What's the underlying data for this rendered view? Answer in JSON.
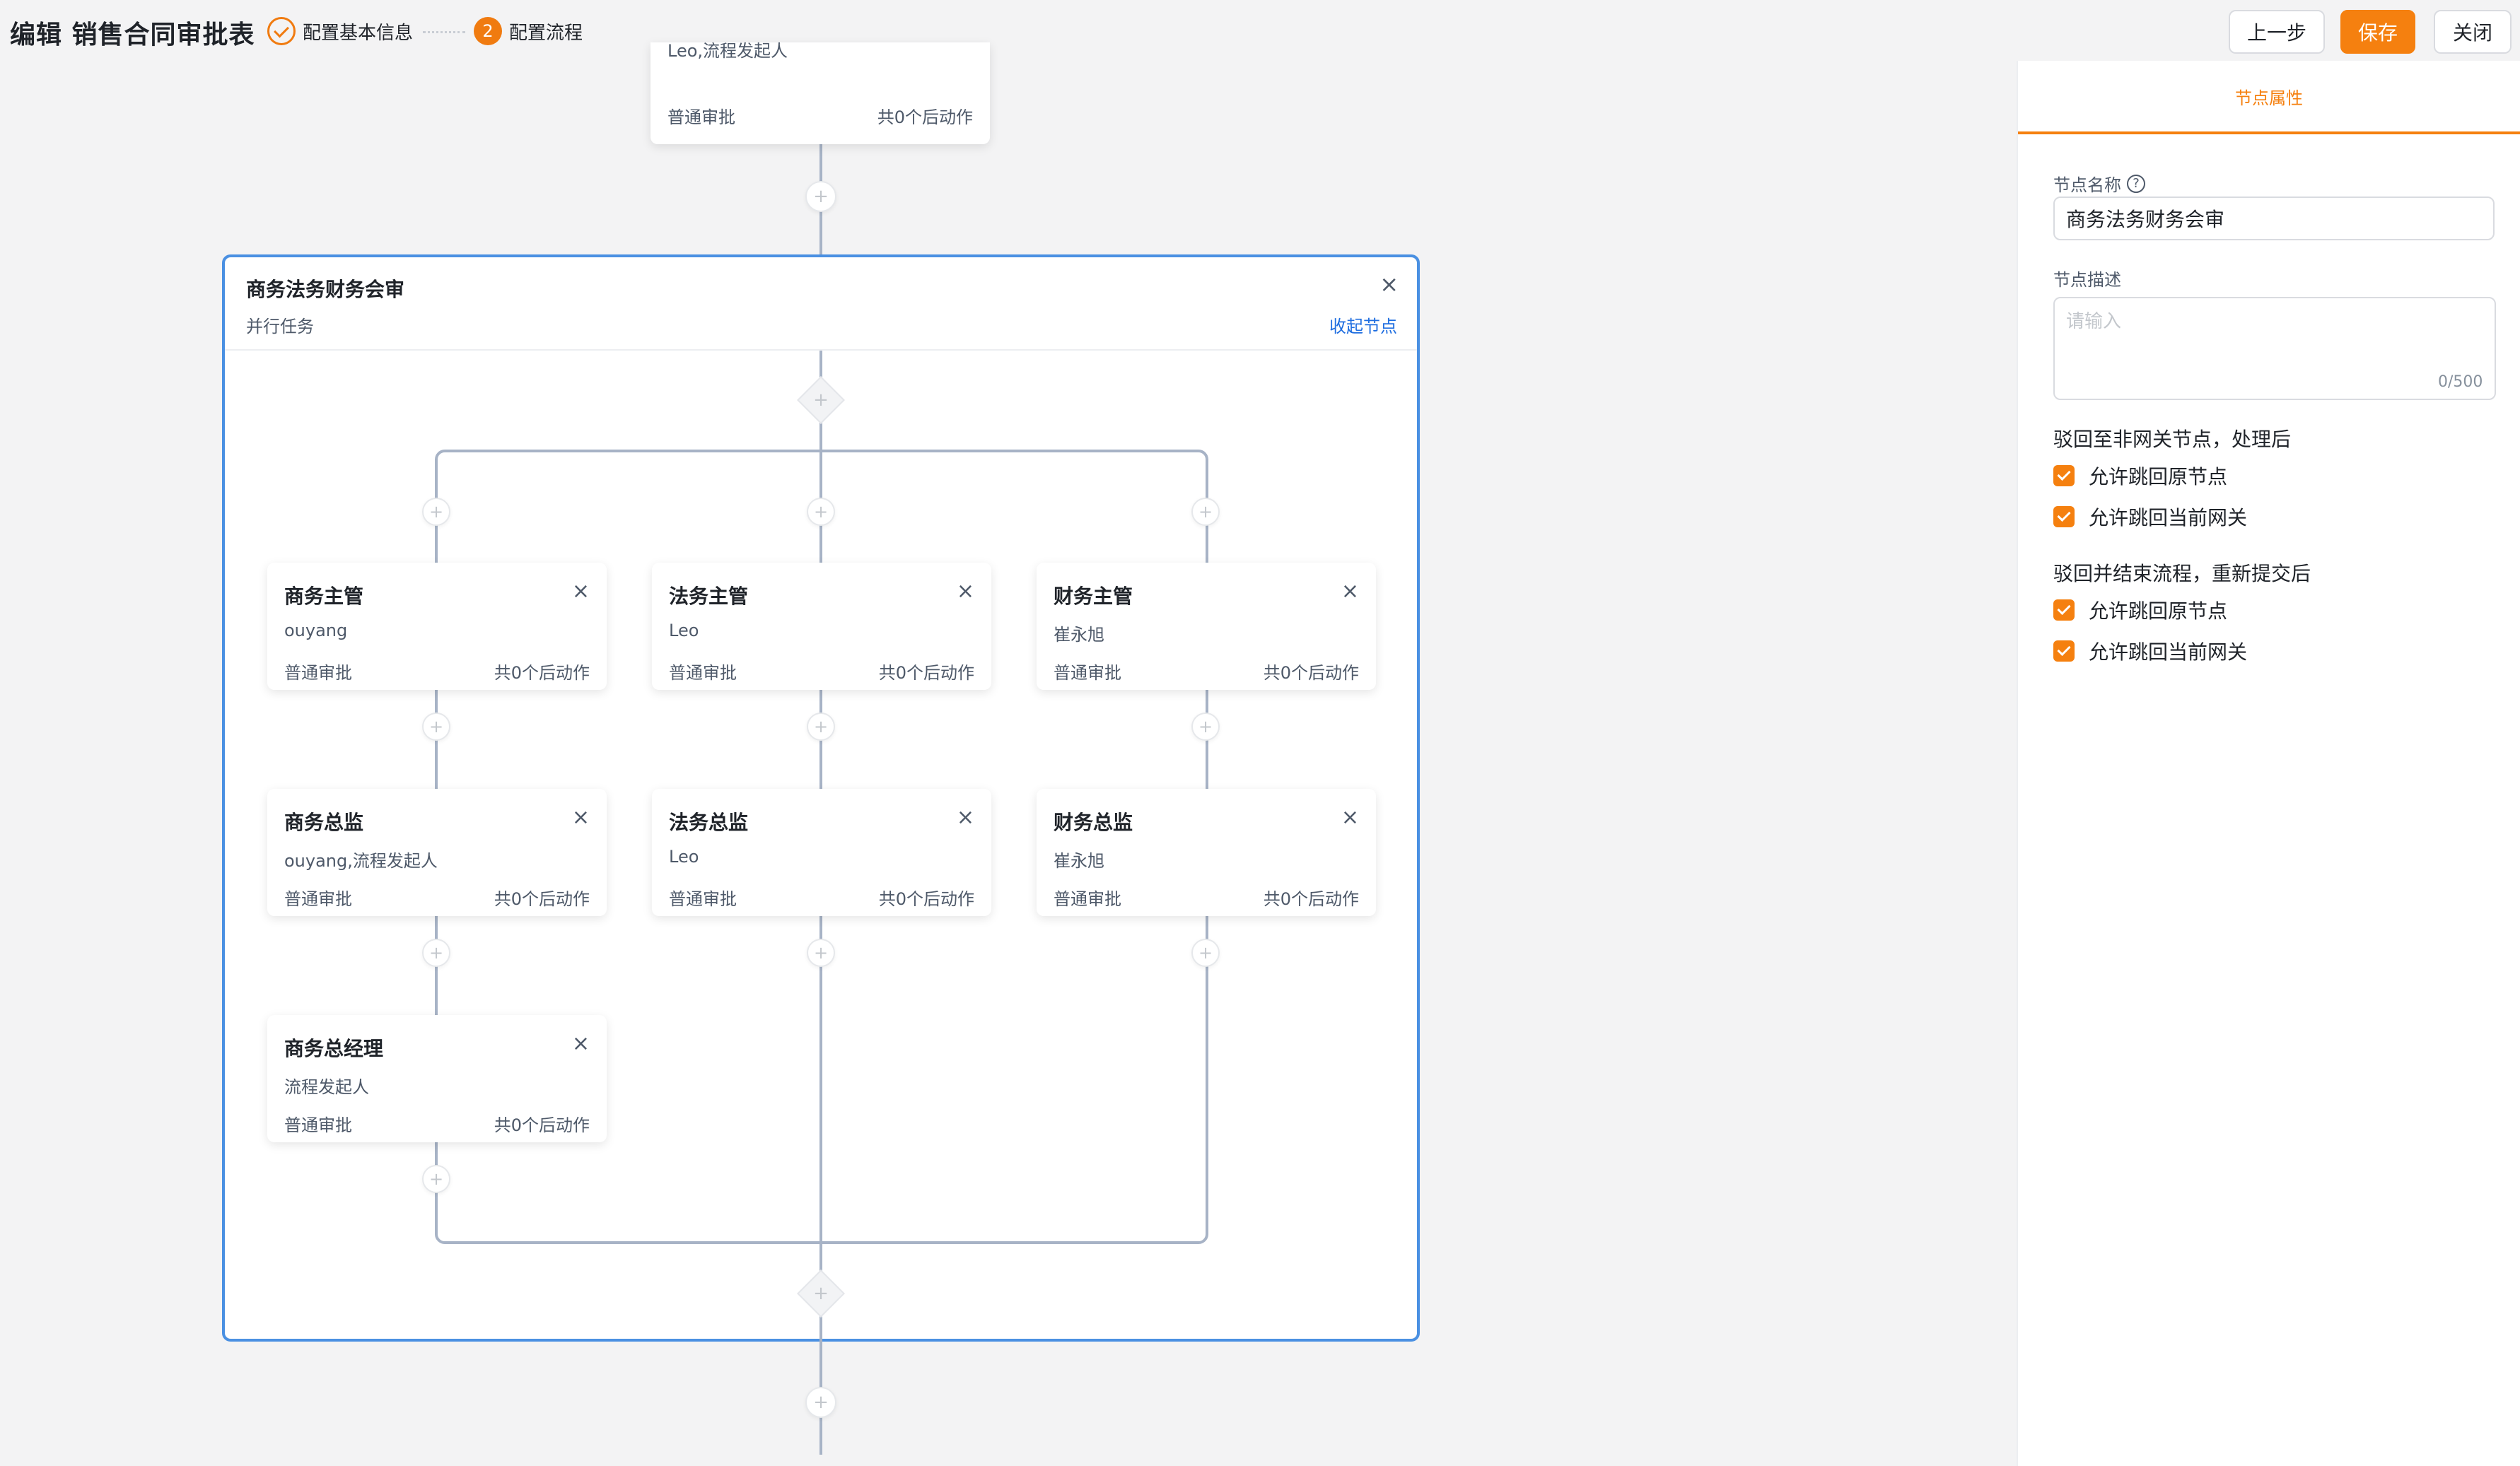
{
  "header": {
    "title": "编辑 销售合同审批表",
    "steps": [
      {
        "label": "配置基本信息",
        "status": "done"
      },
      {
        "label": "配置流程",
        "number": "2",
        "status": "active"
      }
    ],
    "buttons": {
      "prev": "上一步",
      "save": "保存",
      "close": "关闭"
    }
  },
  "canvas": {
    "top_node": {
      "people": "Leo,流程发起人",
      "type": "普通审批",
      "actions": "共0个后动作"
    },
    "group": {
      "title": "商务法务财务会审",
      "subtitle": "并行任务",
      "collapse_label": "收起节点",
      "close_icon": "×"
    },
    "branches": [
      {
        "nodes": [
          {
            "title": "商务主管",
            "people": "ouyang",
            "type": "普通审批",
            "actions": "共0个后动作"
          },
          {
            "title": "商务总监",
            "people": "ouyang,流程发起人",
            "type": "普通审批",
            "actions": "共0个后动作"
          },
          {
            "title": "商务总经理",
            "people": "流程发起人",
            "type": "普通审批",
            "actions": "共0个后动作"
          }
        ]
      },
      {
        "nodes": [
          {
            "title": "法务主管",
            "people": "Leo",
            "type": "普通审批",
            "actions": "共0个后动作"
          },
          {
            "title": "法务总监",
            "people": "Leo",
            "type": "普通审批",
            "actions": "共0个后动作"
          }
        ]
      },
      {
        "nodes": [
          {
            "title": "财务主管",
            "people": "崔永旭",
            "type": "普通审批",
            "actions": "共0个后动作"
          },
          {
            "title": "财务总监",
            "people": "崔永旭",
            "type": "普通审批",
            "actions": "共0个后动作"
          }
        ]
      }
    ],
    "plus_symbol": "+",
    "close_symbol": "×"
  },
  "panel": {
    "tab": "节点属性",
    "name_label": "节点名称",
    "name_value": "商务法务财务会审",
    "help_icon": "?",
    "desc_label": "节点描述",
    "desc_placeholder": "请输入",
    "desc_count": "0/500",
    "section1_title": "驳回至非网关节点，处理后",
    "section1_options": [
      "允许跳回原节点",
      "允许跳回当前网关"
    ],
    "section2_title": "驳回并结束流程，重新提交后",
    "section2_options": [
      "允许跳回原节点",
      "允许跳回当前网关"
    ]
  },
  "colors": {
    "accent": "#f5800f",
    "group_border": "#4a90e2",
    "link": "#1f6ee0",
    "line": "#a7b3c6"
  }
}
